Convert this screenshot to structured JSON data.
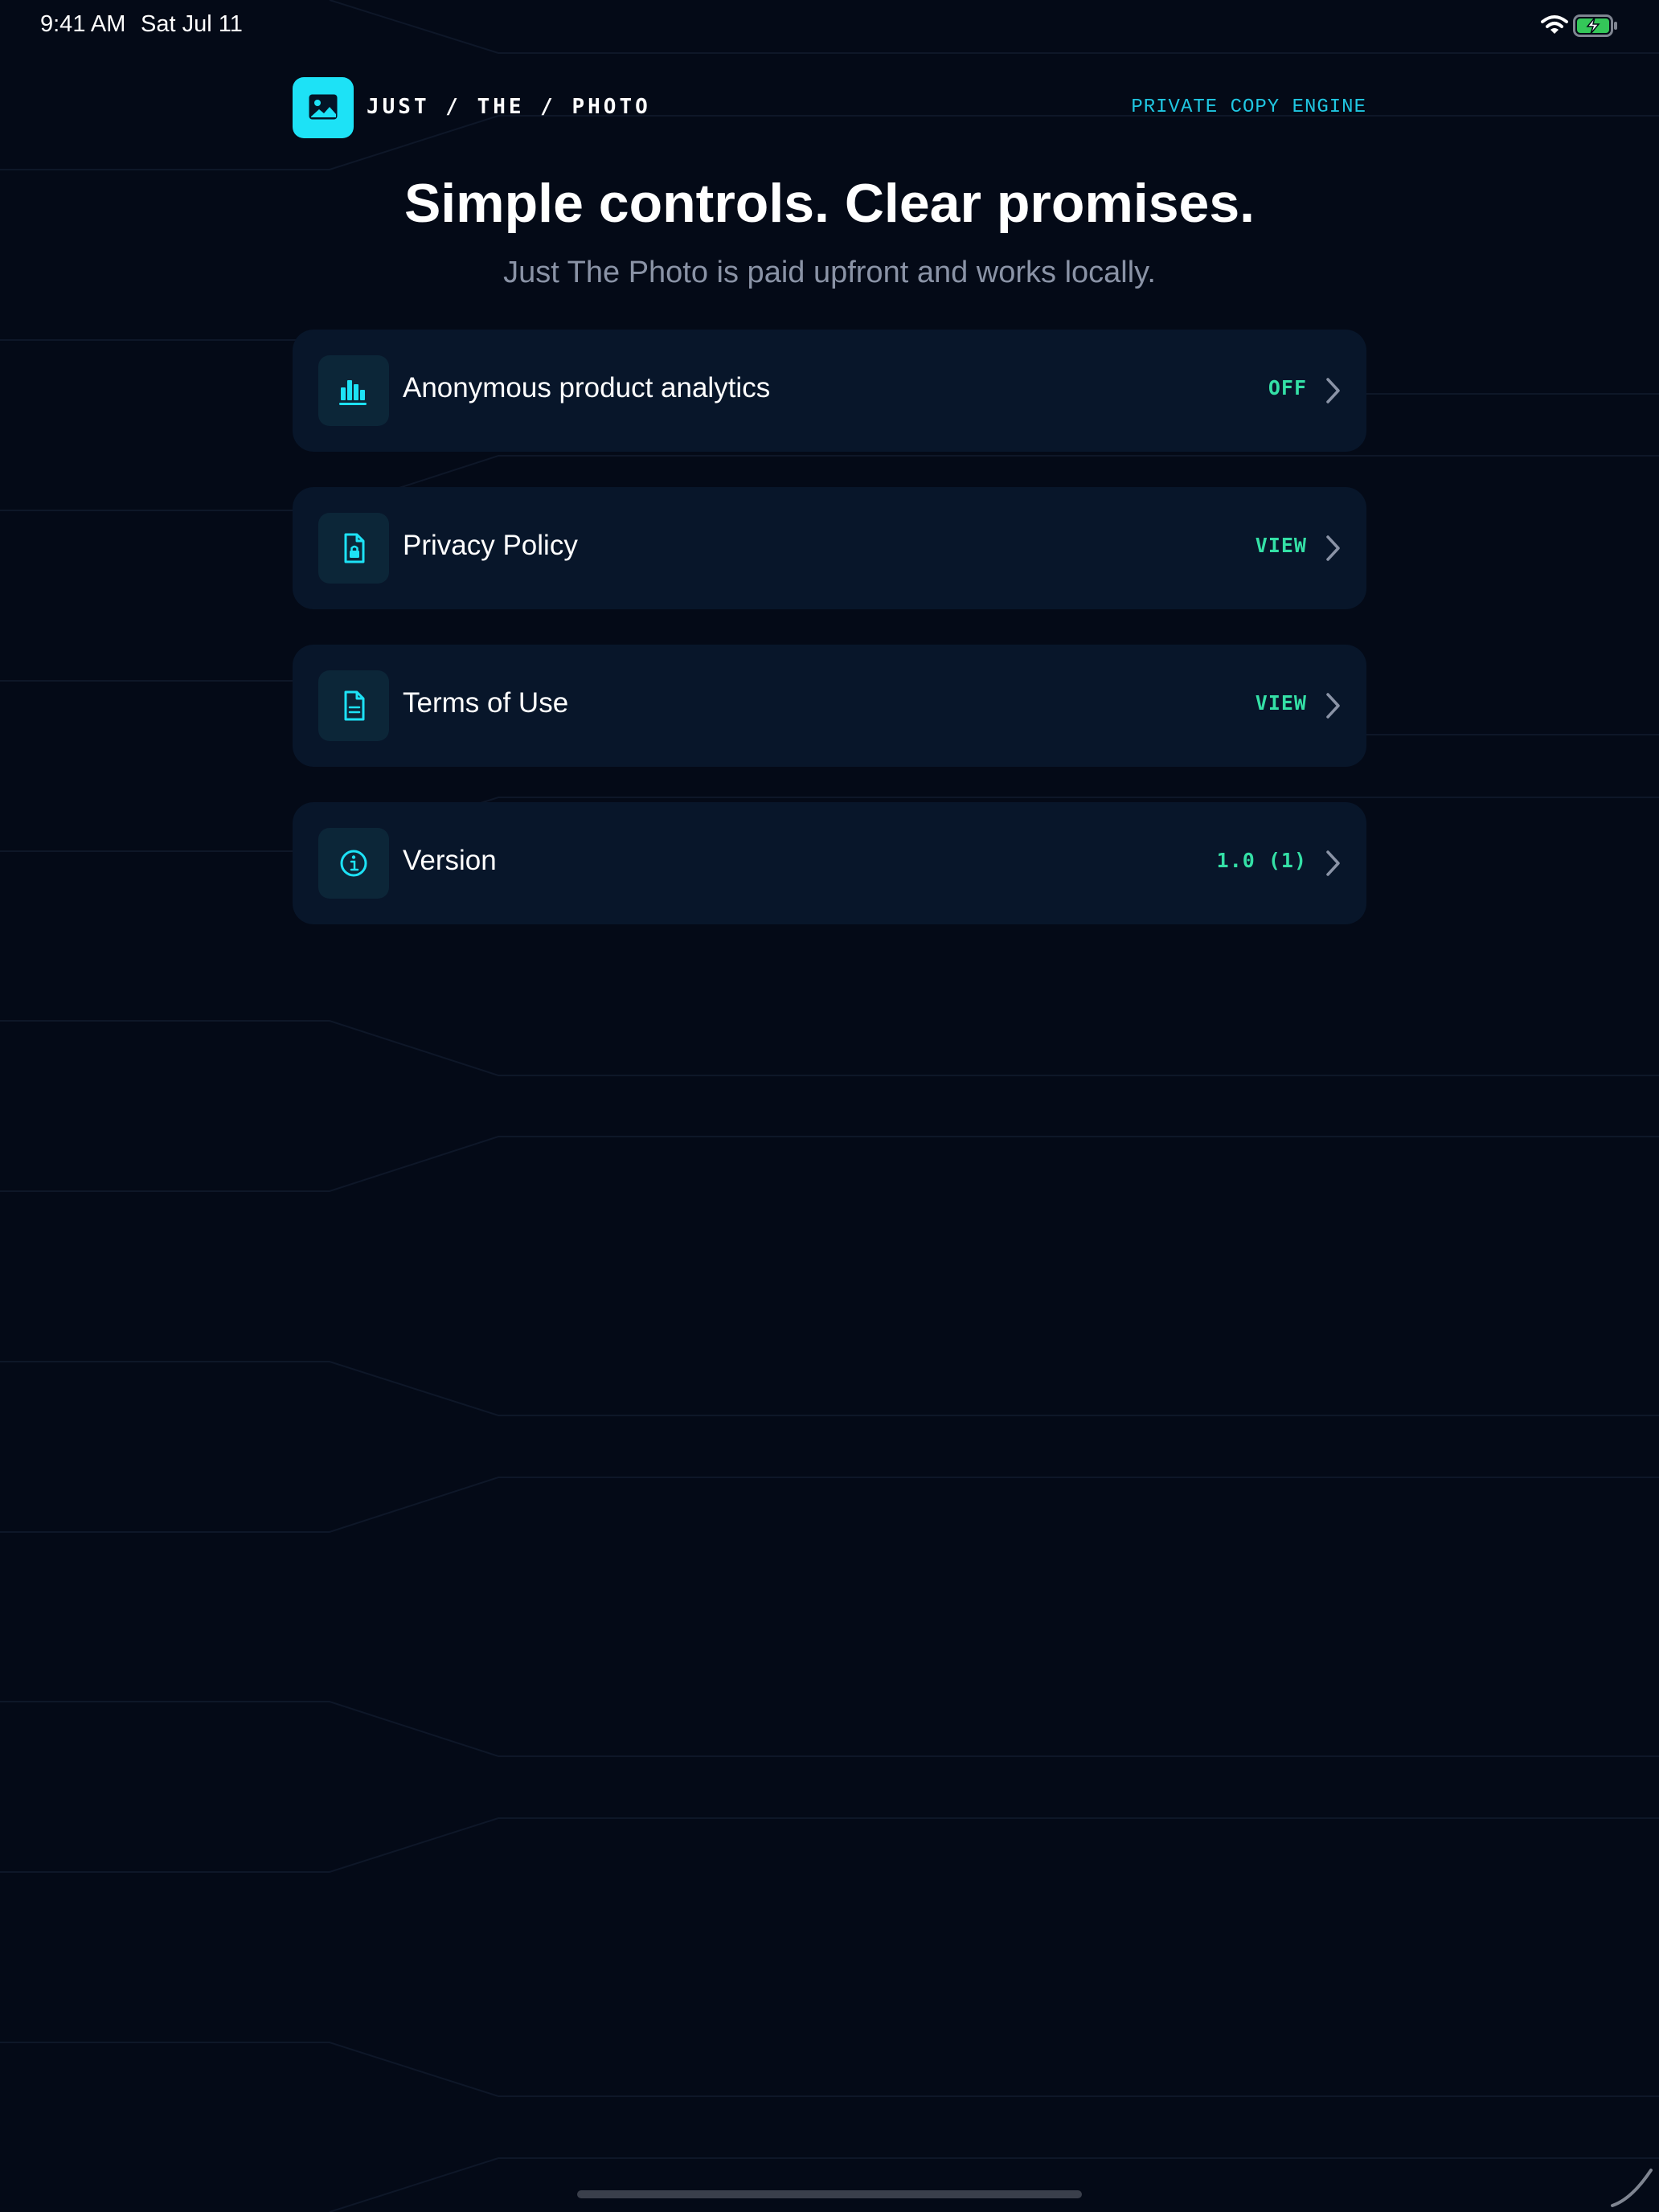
{
  "status_bar": {
    "time": "9:41 AM",
    "date": "Sat Jul 11",
    "wifi_icon": "wifi-icon",
    "battery_icon": "battery-charging-icon",
    "battery_color": "#34c759"
  },
  "header": {
    "logo_icon": "photo-icon",
    "brand": "JUST / THE / PHOTO",
    "tagline": "PRIVATE COPY ENGINE"
  },
  "hero": {
    "title": "Simple controls. Clear promises.",
    "subtitle": "Just The Photo is paid upfront and works locally."
  },
  "settings": [
    {
      "icon": "bar-chart-icon",
      "label": "Anonymous product analytics",
      "value": "OFF"
    },
    {
      "icon": "lock-document-icon",
      "label": "Privacy Policy",
      "value": "VIEW"
    },
    {
      "icon": "document-icon",
      "label": "Terms of Use",
      "value": "VIEW"
    },
    {
      "icon": "info-icon",
      "label": "Version",
      "value": "1.0 (1)"
    }
  ],
  "colors": {
    "background": "#040a17",
    "card": "#08162a",
    "accent": "#1de2f6",
    "value": "#34e0a6",
    "subtitle": "#8a93a6"
  }
}
